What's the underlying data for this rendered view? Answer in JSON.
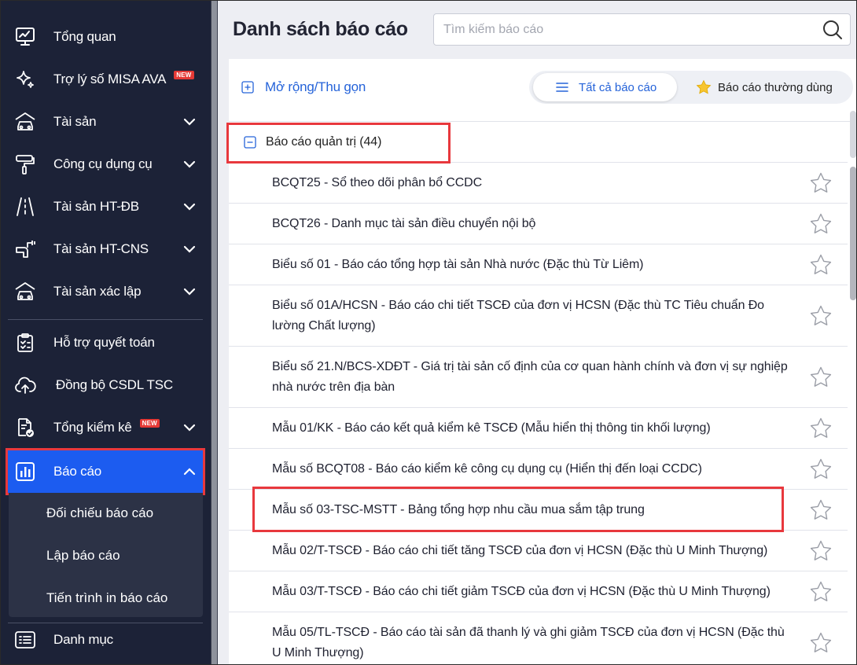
{
  "sidebar": {
    "items": [
      {
        "label": "Tổng quan",
        "icon": "monitor-chart-icon"
      },
      {
        "label": "Trợ lý số MISA AVA",
        "icon": "sparkle-icon",
        "badge": "NEW"
      },
      {
        "label": "Tài sản",
        "icon": "car-house-icon",
        "expandable": true
      },
      {
        "label": "Công cụ dụng cụ",
        "icon": "paint-roller-icon",
        "expandable": true
      },
      {
        "label": "Tài sản HT-ĐB",
        "icon": "road-icon",
        "expandable": true
      },
      {
        "label": "Tài sản HT-CNS",
        "icon": "water-pipe-icon",
        "expandable": true
      },
      {
        "label": "Tài sản xác lập",
        "icon": "car-house-icon",
        "expandable": true
      },
      {
        "label": "Hỗ trợ quyết toán",
        "icon": "clipboard-check-icon"
      },
      {
        "label": "Đồng bộ CSDL TSC",
        "icon": "cloud-upload-icon"
      },
      {
        "label": "Tổng kiểm kê",
        "icon": "document-check-icon",
        "badge": "NEW",
        "expandable": true
      },
      {
        "label": "Báo cáo",
        "icon": "bar-chart-icon",
        "expandable": true,
        "active": true
      },
      {
        "label": "Danh mục",
        "icon": "list-icon"
      }
    ],
    "submenu": [
      {
        "label": "Đối chiếu báo cáo"
      },
      {
        "label": "Lập báo cáo"
      },
      {
        "label": "Tiến trình in báo cáo"
      }
    ]
  },
  "header": {
    "title": "Danh sách báo cáo",
    "search_placeholder": "Tìm kiếm báo cáo",
    "search_value": ""
  },
  "toolbar": {
    "expand_label": "Mở rộng/Thu gọn",
    "tab_all": "Tất cả báo cáo",
    "tab_favorite": "Báo cáo thường dùng",
    "active_tab": "all"
  },
  "group": {
    "label": "Báo cáo quản trị (44)",
    "expanded": true
  },
  "reports": [
    {
      "text": "BCQT25 - Sổ theo dõi phân bổ CCDC"
    },
    {
      "text": "BCQT26 - Danh mục tài sản điều chuyển nội bộ"
    },
    {
      "text": "Biểu số 01 - Báo cáo tổng hợp tài sản Nhà nước (Đặc thù Từ Liêm)"
    },
    {
      "text": "Biểu số 01A/HCSN - Báo cáo chi tiết TSCĐ của đơn vị HCSN (Đặc thù TC Tiêu chuẩn Đo lường Chất lượng)"
    },
    {
      "text": "Biểu số 21.N/BCS-XDĐT - Giá trị tài sản cố định của cơ quan hành chính và đơn vị sự nghiệp nhà nước trên địa bàn"
    },
    {
      "text": "Mẫu 01/KK - Báo cáo kết quả kiểm kê TSCĐ (Mẫu hiển thị thông tin khối lượng)"
    },
    {
      "text": "Mẫu số BCQT08 - Báo cáo kiểm kê công cụ dụng cụ (Hiển thị đến loại CCDC)"
    },
    {
      "text": "Mẫu số 03-TSC-MSTT - Bảng tổng hợp nhu cầu mua sắm tập trung"
    },
    {
      "text": "Mẫu 02/T-TSCĐ - Báo cáo chi tiết tăng TSCĐ của đơn vị HCSN (Đặc thù U Minh Thượng)"
    },
    {
      "text": "Mẫu 03/T-TSCĐ - Báo cáo chi tiết giảm TSCĐ của đơn vị HCSN (Đặc thù U Minh Thượng)"
    },
    {
      "text": "Mẫu 05/TL-TSCĐ - Báo cáo tài sản đã thanh lý và ghi giảm TSCĐ của đơn vị HCSN (Đặc thù U Minh Thượng)"
    }
  ],
  "colors": {
    "sidebar_bg": "#1c2237",
    "active_bg": "#1c5cf0",
    "accent": "#2563d9",
    "highlight": "#e8383d",
    "badge": "#e53935"
  }
}
